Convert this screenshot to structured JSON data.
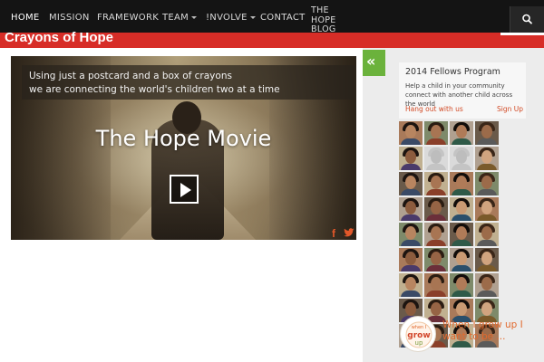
{
  "nav": {
    "items": [
      {
        "label": "HOME",
        "active": true
      },
      {
        "label": "MISSION"
      },
      {
        "label": "FRAMEWORK"
      },
      {
        "label": "TEAM",
        "dropdown": true
      },
      {
        "label": "!NVOLVE",
        "dropdown": true
      },
      {
        "label": "CONTACT"
      }
    ],
    "blog_line1": "THE HOPE",
    "blog_line2": "BLOG",
    "search_icon": "search-icon"
  },
  "header": {
    "site_title": "Crayons of Hope",
    "brand_color": "#d72d27"
  },
  "video": {
    "caption_line1": "Using just a postcard and a box of crayons",
    "caption_line2": "we are connecting the world's children two at a time",
    "title": "The Hope Movie",
    "play_icon": "play-icon",
    "facebook_icon": "facebook-icon",
    "twitter_icon": "twitter-icon"
  },
  "sidebar": {
    "toggle_icon": "double-chevron-left-icon",
    "toggle_color": "#6bb23c",
    "fellows": {
      "title": "2014 Fellows Program",
      "description": "Help a child in your community connect with another child across the world",
      "left_link": "Hang out with us",
      "right_link": "Sign Up"
    },
    "photo_grid": {
      "columns": 4,
      "rows": 9,
      "placeholder_positions": [
        5,
        6
      ]
    },
    "grow": {
      "logo_text_top": "when I",
      "logo_text_main": "grow",
      "logo_text_bottom": "up",
      "text": "When I grow up I want to be ..."
    }
  }
}
